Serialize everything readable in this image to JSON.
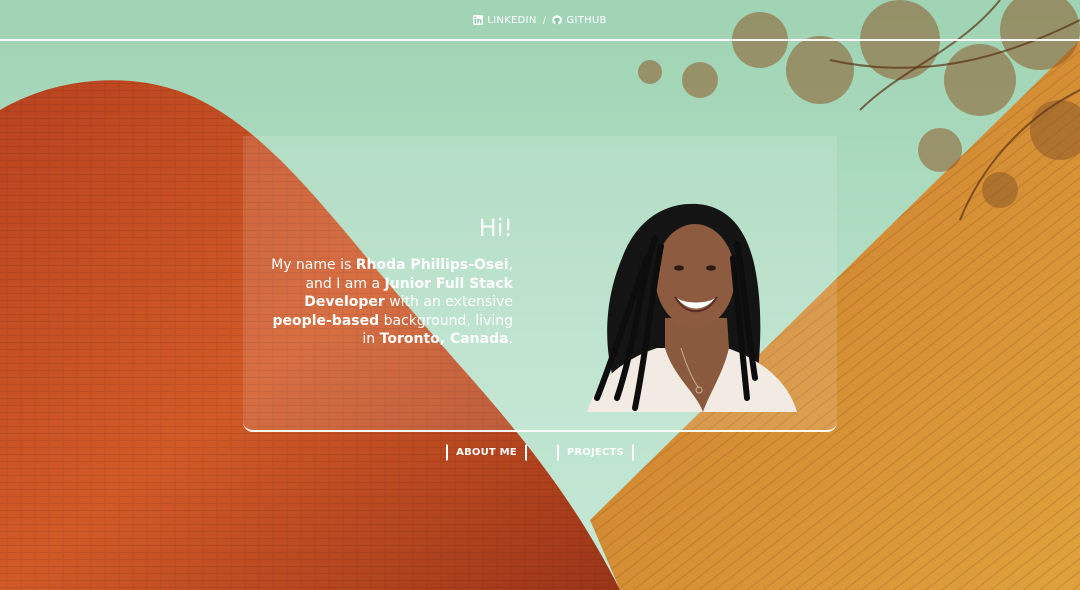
{
  "nav": {
    "links": [
      {
        "label": "LINKEDIN",
        "icon": "linkedin-icon"
      },
      {
        "label": "GITHUB",
        "icon": "github-icon"
      }
    ],
    "separator": "/"
  },
  "hero": {
    "greeting": "Hi!",
    "intro": {
      "p1": "My name is ",
      "name": "Rhoda Phillips-Osei",
      "p2": ", and I am a ",
      "role": "Junior Full Stack Developer",
      "p3": " with an extensive ",
      "background": "people-based",
      "p4": " background, living in ",
      "location": "Toronto, Canada",
      "p5": "."
    }
  },
  "buttons": {
    "about": "ABOUT ME",
    "projects": "PROJECTS"
  },
  "colors": {
    "sky": "#a9d7b8",
    "brick": "#c24f24",
    "wall": "#d6892c",
    "text": "#ffffff"
  }
}
